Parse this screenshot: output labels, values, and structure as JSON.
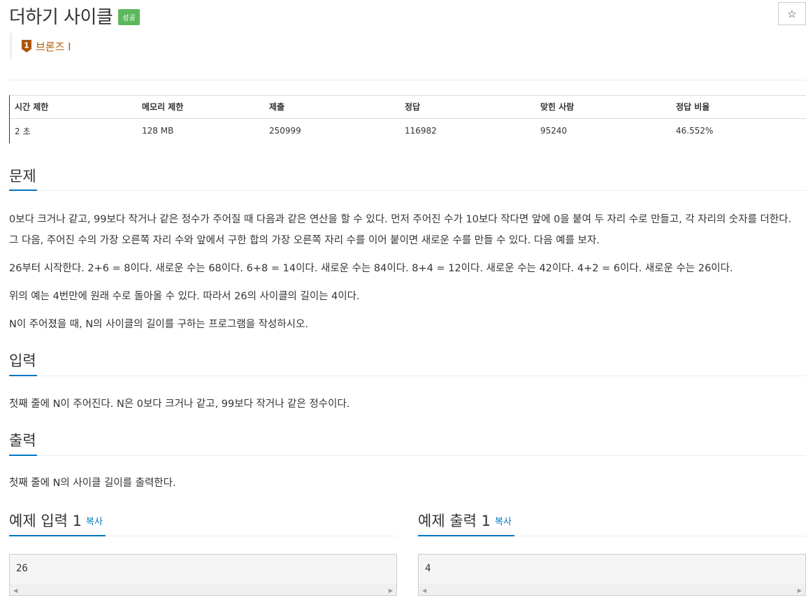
{
  "problem": {
    "title": "더하기 사이클",
    "badge": "성공",
    "star": "☆",
    "tier_number": "1",
    "tier_label": "브론즈 I",
    "tier_color": "#ad5600"
  },
  "info_table": {
    "headers": [
      "시간 제한",
      "메모리 제한",
      "제출",
      "정답",
      "맞힌 사람",
      "정답 비율"
    ],
    "values": [
      "2 초",
      "128 MB",
      "250999",
      "116982",
      "95240",
      "46.552%"
    ]
  },
  "sections": {
    "problem_heading": "문제",
    "problem_paragraphs": [
      "0보다 크거나 같고, 99보다 작거나 같은 정수가 주어질 때 다음과 같은 연산을 할 수 있다. 먼저 주어진 수가 10보다 작다면 앞에 0을 붙여 두 자리 수로 만들고, 각 자리의 숫자를 더한다. 그 다음, 주어진 수의 가장 오른쪽 자리 수와 앞에서 구한 합의 가장 오른쪽 자리 수를 이어 붙이면 새로운 수를 만들 수 있다. 다음 예를 보자.",
      "26부터 시작한다. 2+6 = 8이다. 새로운 수는 68이다. 6+8 = 14이다. 새로운 수는 84이다. 8+4 = 12이다. 새로운 수는 42이다. 4+2 = 6이다. 새로운 수는 26이다.",
      "위의 예는 4번만에 원래 수로 돌아올 수 있다. 따라서 26의 사이클의 길이는 4이다.",
      "N이 주어졌을 때, N의 사이클의 길이를 구하는 프로그램을 작성하시오."
    ],
    "input_heading": "입력",
    "input_text": "첫째 줄에 N이 주어진다. N은 0보다 크거나 같고, 99보다 작거나 같은 정수이다.",
    "output_heading": "출력",
    "output_text": "첫째 줄에 N의 사이클 길이를 출력한다."
  },
  "samples": {
    "input_title": "예제 입력 1",
    "output_title": "예제 출력 1",
    "copy_label": "복사",
    "input_value": "26",
    "output_value": "4"
  },
  "colors": {
    "accent": "#0076c0",
    "success": "#5cb85c"
  }
}
